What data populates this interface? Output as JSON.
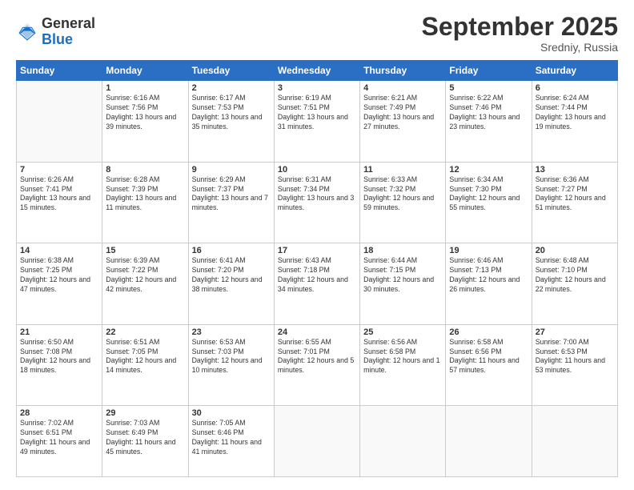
{
  "logo": {
    "general": "General",
    "blue": "Blue"
  },
  "title": "September 2025",
  "location": "Sredniy, Russia",
  "days_header": [
    "Sunday",
    "Monday",
    "Tuesday",
    "Wednesday",
    "Thursday",
    "Friday",
    "Saturday"
  ],
  "weeks": [
    [
      {
        "day": "",
        "sunrise": "",
        "sunset": "",
        "daylight": ""
      },
      {
        "day": "1",
        "sunrise": "Sunrise: 6:16 AM",
        "sunset": "Sunset: 7:56 PM",
        "daylight": "Daylight: 13 hours and 39 minutes."
      },
      {
        "day": "2",
        "sunrise": "Sunrise: 6:17 AM",
        "sunset": "Sunset: 7:53 PM",
        "daylight": "Daylight: 13 hours and 35 minutes."
      },
      {
        "day": "3",
        "sunrise": "Sunrise: 6:19 AM",
        "sunset": "Sunset: 7:51 PM",
        "daylight": "Daylight: 13 hours and 31 minutes."
      },
      {
        "day": "4",
        "sunrise": "Sunrise: 6:21 AM",
        "sunset": "Sunset: 7:49 PM",
        "daylight": "Daylight: 13 hours and 27 minutes."
      },
      {
        "day": "5",
        "sunrise": "Sunrise: 6:22 AM",
        "sunset": "Sunset: 7:46 PM",
        "daylight": "Daylight: 13 hours and 23 minutes."
      },
      {
        "day": "6",
        "sunrise": "Sunrise: 6:24 AM",
        "sunset": "Sunset: 7:44 PM",
        "daylight": "Daylight: 13 hours and 19 minutes."
      }
    ],
    [
      {
        "day": "7",
        "sunrise": "Sunrise: 6:26 AM",
        "sunset": "Sunset: 7:41 PM",
        "daylight": "Daylight: 13 hours and 15 minutes."
      },
      {
        "day": "8",
        "sunrise": "Sunrise: 6:28 AM",
        "sunset": "Sunset: 7:39 PM",
        "daylight": "Daylight: 13 hours and 11 minutes."
      },
      {
        "day": "9",
        "sunrise": "Sunrise: 6:29 AM",
        "sunset": "Sunset: 7:37 PM",
        "daylight": "Daylight: 13 hours and 7 minutes."
      },
      {
        "day": "10",
        "sunrise": "Sunrise: 6:31 AM",
        "sunset": "Sunset: 7:34 PM",
        "daylight": "Daylight: 13 hours and 3 minutes."
      },
      {
        "day": "11",
        "sunrise": "Sunrise: 6:33 AM",
        "sunset": "Sunset: 7:32 PM",
        "daylight": "Daylight: 12 hours and 59 minutes."
      },
      {
        "day": "12",
        "sunrise": "Sunrise: 6:34 AM",
        "sunset": "Sunset: 7:30 PM",
        "daylight": "Daylight: 12 hours and 55 minutes."
      },
      {
        "day": "13",
        "sunrise": "Sunrise: 6:36 AM",
        "sunset": "Sunset: 7:27 PM",
        "daylight": "Daylight: 12 hours and 51 minutes."
      }
    ],
    [
      {
        "day": "14",
        "sunrise": "Sunrise: 6:38 AM",
        "sunset": "Sunset: 7:25 PM",
        "daylight": "Daylight: 12 hours and 47 minutes."
      },
      {
        "day": "15",
        "sunrise": "Sunrise: 6:39 AM",
        "sunset": "Sunset: 7:22 PM",
        "daylight": "Daylight: 12 hours and 42 minutes."
      },
      {
        "day": "16",
        "sunrise": "Sunrise: 6:41 AM",
        "sunset": "Sunset: 7:20 PM",
        "daylight": "Daylight: 12 hours and 38 minutes."
      },
      {
        "day": "17",
        "sunrise": "Sunrise: 6:43 AM",
        "sunset": "Sunset: 7:18 PM",
        "daylight": "Daylight: 12 hours and 34 minutes."
      },
      {
        "day": "18",
        "sunrise": "Sunrise: 6:44 AM",
        "sunset": "Sunset: 7:15 PM",
        "daylight": "Daylight: 12 hours and 30 minutes."
      },
      {
        "day": "19",
        "sunrise": "Sunrise: 6:46 AM",
        "sunset": "Sunset: 7:13 PM",
        "daylight": "Daylight: 12 hours and 26 minutes."
      },
      {
        "day": "20",
        "sunrise": "Sunrise: 6:48 AM",
        "sunset": "Sunset: 7:10 PM",
        "daylight": "Daylight: 12 hours and 22 minutes."
      }
    ],
    [
      {
        "day": "21",
        "sunrise": "Sunrise: 6:50 AM",
        "sunset": "Sunset: 7:08 PM",
        "daylight": "Daylight: 12 hours and 18 minutes."
      },
      {
        "day": "22",
        "sunrise": "Sunrise: 6:51 AM",
        "sunset": "Sunset: 7:05 PM",
        "daylight": "Daylight: 12 hours and 14 minutes."
      },
      {
        "day": "23",
        "sunrise": "Sunrise: 6:53 AM",
        "sunset": "Sunset: 7:03 PM",
        "daylight": "Daylight: 12 hours and 10 minutes."
      },
      {
        "day": "24",
        "sunrise": "Sunrise: 6:55 AM",
        "sunset": "Sunset: 7:01 PM",
        "daylight": "Daylight: 12 hours and 5 minutes."
      },
      {
        "day": "25",
        "sunrise": "Sunrise: 6:56 AM",
        "sunset": "Sunset: 6:58 PM",
        "daylight": "Daylight: 12 hours and 1 minute."
      },
      {
        "day": "26",
        "sunrise": "Sunrise: 6:58 AM",
        "sunset": "Sunset: 6:56 PM",
        "daylight": "Daylight: 11 hours and 57 minutes."
      },
      {
        "day": "27",
        "sunrise": "Sunrise: 7:00 AM",
        "sunset": "Sunset: 6:53 PM",
        "daylight": "Daylight: 11 hours and 53 minutes."
      }
    ],
    [
      {
        "day": "28",
        "sunrise": "Sunrise: 7:02 AM",
        "sunset": "Sunset: 6:51 PM",
        "daylight": "Daylight: 11 hours and 49 minutes."
      },
      {
        "day": "29",
        "sunrise": "Sunrise: 7:03 AM",
        "sunset": "Sunset: 6:49 PM",
        "daylight": "Daylight: 11 hours and 45 minutes."
      },
      {
        "day": "30",
        "sunrise": "Sunrise: 7:05 AM",
        "sunset": "Sunset: 6:46 PM",
        "daylight": "Daylight: 11 hours and 41 minutes."
      },
      {
        "day": "",
        "sunrise": "",
        "sunset": "",
        "daylight": ""
      },
      {
        "day": "",
        "sunrise": "",
        "sunset": "",
        "daylight": ""
      },
      {
        "day": "",
        "sunrise": "",
        "sunset": "",
        "daylight": ""
      },
      {
        "day": "",
        "sunrise": "",
        "sunset": "",
        "daylight": ""
      }
    ]
  ]
}
